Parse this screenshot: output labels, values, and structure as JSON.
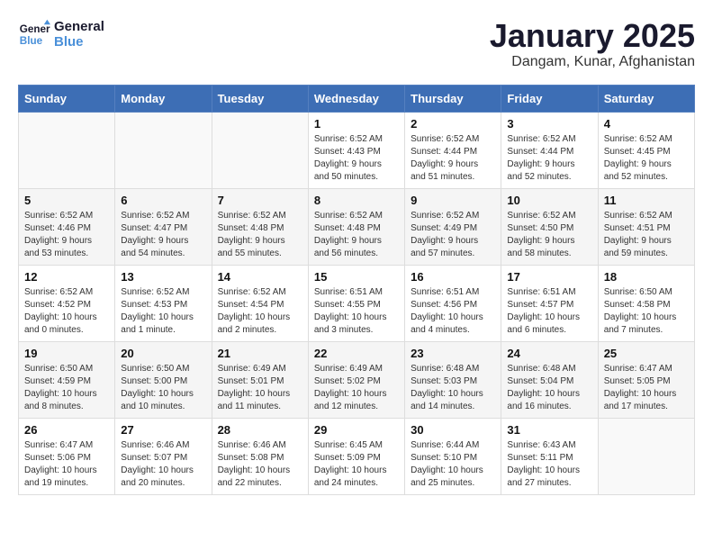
{
  "logo": {
    "line1": "General",
    "line2": "Blue"
  },
  "title": "January 2025",
  "subtitle": "Dangam, Kunar, Afghanistan",
  "weekdays": [
    "Sunday",
    "Monday",
    "Tuesday",
    "Wednesday",
    "Thursday",
    "Friday",
    "Saturday"
  ],
  "weeks": [
    [
      {
        "day": "",
        "info": ""
      },
      {
        "day": "",
        "info": ""
      },
      {
        "day": "",
        "info": ""
      },
      {
        "day": "1",
        "info": "Sunrise: 6:52 AM\nSunset: 4:43 PM\nDaylight: 9 hours\nand 50 minutes."
      },
      {
        "day": "2",
        "info": "Sunrise: 6:52 AM\nSunset: 4:44 PM\nDaylight: 9 hours\nand 51 minutes."
      },
      {
        "day": "3",
        "info": "Sunrise: 6:52 AM\nSunset: 4:44 PM\nDaylight: 9 hours\nand 52 minutes."
      },
      {
        "day": "4",
        "info": "Sunrise: 6:52 AM\nSunset: 4:45 PM\nDaylight: 9 hours\nand 52 minutes."
      }
    ],
    [
      {
        "day": "5",
        "info": "Sunrise: 6:52 AM\nSunset: 4:46 PM\nDaylight: 9 hours\nand 53 minutes."
      },
      {
        "day": "6",
        "info": "Sunrise: 6:52 AM\nSunset: 4:47 PM\nDaylight: 9 hours\nand 54 minutes."
      },
      {
        "day": "7",
        "info": "Sunrise: 6:52 AM\nSunset: 4:48 PM\nDaylight: 9 hours\nand 55 minutes."
      },
      {
        "day": "8",
        "info": "Sunrise: 6:52 AM\nSunset: 4:48 PM\nDaylight: 9 hours\nand 56 minutes."
      },
      {
        "day": "9",
        "info": "Sunrise: 6:52 AM\nSunset: 4:49 PM\nDaylight: 9 hours\nand 57 minutes."
      },
      {
        "day": "10",
        "info": "Sunrise: 6:52 AM\nSunset: 4:50 PM\nDaylight: 9 hours\nand 58 minutes."
      },
      {
        "day": "11",
        "info": "Sunrise: 6:52 AM\nSunset: 4:51 PM\nDaylight: 9 hours\nand 59 minutes."
      }
    ],
    [
      {
        "day": "12",
        "info": "Sunrise: 6:52 AM\nSunset: 4:52 PM\nDaylight: 10 hours\nand 0 minutes."
      },
      {
        "day": "13",
        "info": "Sunrise: 6:52 AM\nSunset: 4:53 PM\nDaylight: 10 hours\nand 1 minute."
      },
      {
        "day": "14",
        "info": "Sunrise: 6:52 AM\nSunset: 4:54 PM\nDaylight: 10 hours\nand 2 minutes."
      },
      {
        "day": "15",
        "info": "Sunrise: 6:51 AM\nSunset: 4:55 PM\nDaylight: 10 hours\nand 3 minutes."
      },
      {
        "day": "16",
        "info": "Sunrise: 6:51 AM\nSunset: 4:56 PM\nDaylight: 10 hours\nand 4 minutes."
      },
      {
        "day": "17",
        "info": "Sunrise: 6:51 AM\nSunset: 4:57 PM\nDaylight: 10 hours\nand 6 minutes."
      },
      {
        "day": "18",
        "info": "Sunrise: 6:50 AM\nSunset: 4:58 PM\nDaylight: 10 hours\nand 7 minutes."
      }
    ],
    [
      {
        "day": "19",
        "info": "Sunrise: 6:50 AM\nSunset: 4:59 PM\nDaylight: 10 hours\nand 8 minutes."
      },
      {
        "day": "20",
        "info": "Sunrise: 6:50 AM\nSunset: 5:00 PM\nDaylight: 10 hours\nand 10 minutes."
      },
      {
        "day": "21",
        "info": "Sunrise: 6:49 AM\nSunset: 5:01 PM\nDaylight: 10 hours\nand 11 minutes."
      },
      {
        "day": "22",
        "info": "Sunrise: 6:49 AM\nSunset: 5:02 PM\nDaylight: 10 hours\nand 12 minutes."
      },
      {
        "day": "23",
        "info": "Sunrise: 6:48 AM\nSunset: 5:03 PM\nDaylight: 10 hours\nand 14 minutes."
      },
      {
        "day": "24",
        "info": "Sunrise: 6:48 AM\nSunset: 5:04 PM\nDaylight: 10 hours\nand 16 minutes."
      },
      {
        "day": "25",
        "info": "Sunrise: 6:47 AM\nSunset: 5:05 PM\nDaylight: 10 hours\nand 17 minutes."
      }
    ],
    [
      {
        "day": "26",
        "info": "Sunrise: 6:47 AM\nSunset: 5:06 PM\nDaylight: 10 hours\nand 19 minutes."
      },
      {
        "day": "27",
        "info": "Sunrise: 6:46 AM\nSunset: 5:07 PM\nDaylight: 10 hours\nand 20 minutes."
      },
      {
        "day": "28",
        "info": "Sunrise: 6:46 AM\nSunset: 5:08 PM\nDaylight: 10 hours\nand 22 minutes."
      },
      {
        "day": "29",
        "info": "Sunrise: 6:45 AM\nSunset: 5:09 PM\nDaylight: 10 hours\nand 24 minutes."
      },
      {
        "day": "30",
        "info": "Sunrise: 6:44 AM\nSunset: 5:10 PM\nDaylight: 10 hours\nand 25 minutes."
      },
      {
        "day": "31",
        "info": "Sunrise: 6:43 AM\nSunset: 5:11 PM\nDaylight: 10 hours\nand 27 minutes."
      },
      {
        "day": "",
        "info": ""
      }
    ]
  ]
}
